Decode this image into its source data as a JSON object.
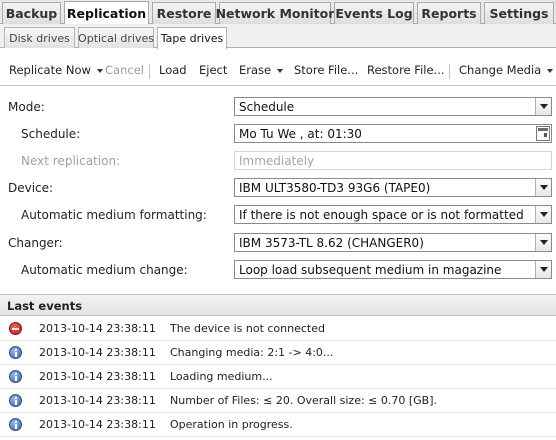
{
  "main_tabs": [
    "Backup",
    "Replication",
    "Restore",
    "Network Monitor",
    "Events Log",
    "Reports",
    "Settings"
  ],
  "sub_tabs": [
    "Disk drives",
    "Optical drives",
    "Tape drives"
  ],
  "toolbar": {
    "replicate_now": "Replicate Now",
    "cancel": "Cancel",
    "load": "Load",
    "eject": "Eject",
    "erase": "Erase",
    "store_file": "Store File...",
    "restore_file": "Restore File...",
    "change_media": "Change Media"
  },
  "form": {
    "mode_label": "Mode:",
    "mode_value": "Schedule",
    "schedule_label": "Schedule:",
    "schedule_value": "Mo Tu We , at: 01:30",
    "next_label": "Next replication:",
    "next_placeholder": "Immediately",
    "device_label": "Device:",
    "device_value": "IBM ULT3580-TD3 93G6 (TAPE0)",
    "formatting_label": "Automatic medium formatting:",
    "formatting_value": "If there is not enough space or is not formatted",
    "changer_label": "Changer:",
    "changer_value": "IBM 3573-TL 8.62 (CHANGER0)",
    "change_label": "Automatic medium change:",
    "change_value": "Loop load subsequent medium in magazine"
  },
  "events": {
    "title": "Last events",
    "rows": [
      {
        "icon": "error-icon",
        "time": "2013-10-14 23:38:11",
        "message": "The device is not connected"
      },
      {
        "icon": "info-icon",
        "time": "2013-10-14 23:38:11",
        "message": "Changing media: 2:1 -> 4:0..."
      },
      {
        "icon": "info-icon",
        "time": "2013-10-14 23:38:11",
        "message": "Loading medium..."
      },
      {
        "icon": "info-icon",
        "time": "2013-10-14 23:38:11",
        "message": "Number of Files: ≤ 20. Overall size: ≤ 0.70 [GB]."
      },
      {
        "icon": "info-icon",
        "time": "2013-10-14 23:38:11",
        "message": "Operation in progress."
      }
    ]
  },
  "colors": {
    "error": "#c0181a",
    "info": "#3b62ad",
    "tab_border": "#a9a9a9"
  }
}
